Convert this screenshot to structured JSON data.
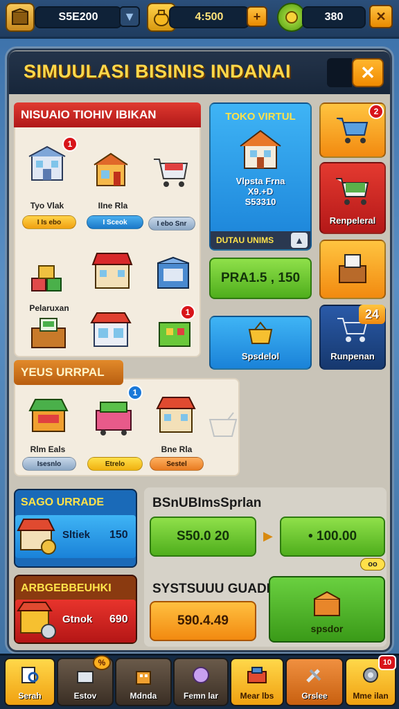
{
  "topbar": {
    "resource1_value": "S5E200",
    "resource2_value": "4:500",
    "resource3_value": "380",
    "add_symbol": "+",
    "dropdown_symbol": "▼",
    "close_symbol": "✕"
  },
  "title": {
    "text": "SIMUULASI BISINIS INDANAI",
    "close_symbol": "✕"
  },
  "section1": {
    "header": "NISUAIO TIOHIV IBIKAN",
    "items": [
      {
        "label": "Tyo Vlak",
        "chip": "I Is ebo",
        "badge": "1"
      },
      {
        "label": "IIne Rla",
        "chip": "I Sceok"
      },
      {
        "label": "",
        "chip": "I ebo Snr"
      },
      {
        "label": ""
      },
      {
        "label": ""
      },
      {
        "label": ""
      },
      {
        "label": "Pelaruxan"
      },
      {
        "label": ""
      },
      {
        "label": "",
        "badge": "1"
      }
    ]
  },
  "toko": {
    "title": "TOKO VIRTUL",
    "name": "Vlpsta Frna",
    "line2": "X9.+D",
    "price": "S53310",
    "footer": "DUTAU UNIMS"
  },
  "side_tiles": [
    {
      "label": "",
      "badge": "2"
    },
    {
      "label": "Renpeleral"
    },
    {
      "label": ""
    },
    {
      "label": "Runpenan",
      "badge": "24"
    }
  ],
  "center_buttons": {
    "green_text": "PRA1.5 , 150",
    "blue_text": "Spsdelol"
  },
  "section2": {
    "header": "YEUS URRPAL",
    "items": [
      {
        "label": "Rlm Eals",
        "chip": "Isesnlo"
      },
      {
        "label": "",
        "chip": "Etrelo",
        "badge": "1"
      },
      {
        "label": "Bne Rla",
        "chip": "Sestel"
      },
      {
        "label": ""
      }
    ]
  },
  "upgrade1": {
    "header": "SAGO URRADE",
    "label": "Sltiek",
    "value": "150"
  },
  "upgrade2": {
    "header": "ARBGEBBEUHKI",
    "label": "Gtnok",
    "value": "690"
  },
  "shop_panel": {
    "header": "BSnUBImsSprlan",
    "button1": "S50.0 20",
    "arrow": "▶",
    "button2": "• 100.00",
    "small_chip": "oo",
    "header2": "SYSTSUUU GUADE",
    "button3": "590.4.49",
    "big_button": "spsdor"
  },
  "bottom_nav": [
    {
      "label": "Serah"
    },
    {
      "label": "Estov",
      "badge": "%"
    },
    {
      "label": "Mdnda"
    },
    {
      "label": "Femn lar"
    },
    {
      "label": "Mear lbs"
    },
    {
      "label": "Grslee"
    },
    {
      "label": "Mme ilan",
      "badge": "10"
    }
  ],
  "colors": {
    "accent_yellow": "#ffd84a",
    "orange": "#f28a10",
    "green": "#4fae1c",
    "blue": "#1a8fe0",
    "red_header": "#c21e22"
  }
}
